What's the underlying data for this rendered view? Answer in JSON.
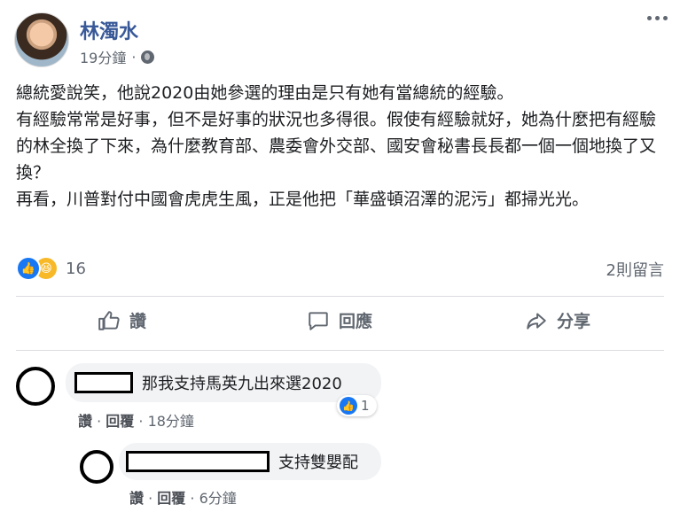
{
  "post": {
    "author": "林濁水",
    "time": "19分鐘",
    "privacy_icon": "globe-icon",
    "lines": [
      "總統愛說笑，他說2020由她參選的理由是只有她有當總統的經驗。",
      "有經驗常常是好事，但不是好事的狀況也多得很。假使有經驗就好，她為什麼把有經驗的林全換了下來，為什麼教育部、農委會外交部、國安會秘書長長都一個一個地換了又換？",
      "再看，川普對付中國會虎虎生風，正是他把「華盛頓沼澤的泥污」都掃光光。"
    ]
  },
  "reactions": {
    "count": "16",
    "comments_count": "2則留言"
  },
  "actions": {
    "like": "讚",
    "comment": "回應",
    "share": "分享"
  },
  "comments": [
    {
      "text": "那我支持馬英九出來選2020",
      "like": "讚",
      "reply": "回覆",
      "time": "18分鐘",
      "like_count": "1"
    },
    {
      "text": "支持雙嬰配",
      "like": "讚",
      "reply": "回覆",
      "time": "6分鐘"
    }
  ],
  "colors": {
    "link": "#385898",
    "like_blue": "#1877f2",
    "muted": "#606770"
  }
}
